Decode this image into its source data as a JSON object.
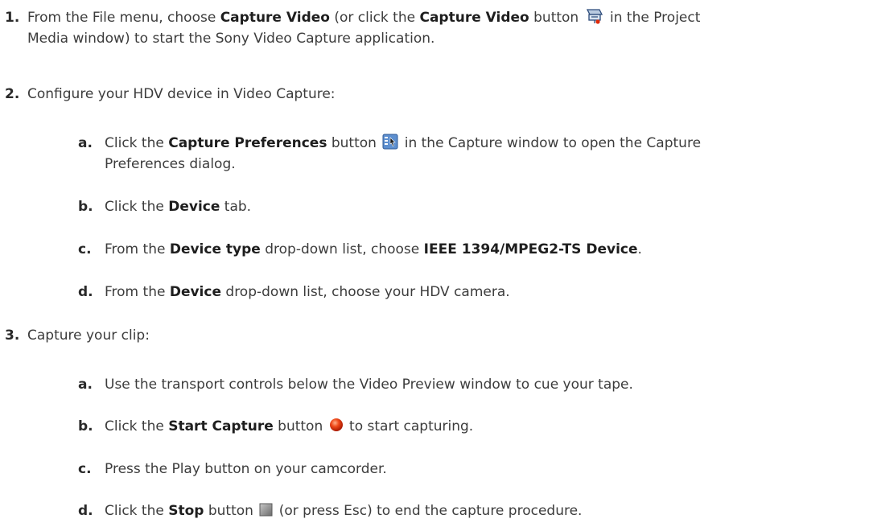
{
  "s1": {
    "num": "1.",
    "t1": "From the File menu, choose ",
    "b1": "Capture Video",
    "t2": " (or click the ",
    "b2": "Capture Video",
    "t3": " button ",
    "t4": " in the Project",
    "t5": "Media window) to start the Sony Video Capture application."
  },
  "s2": {
    "num": "2.",
    "text": "Configure your HDV device in Video Capture:",
    "a": {
      "letter": "a.",
      "t1": "Click the ",
      "b1": "Capture Preferences",
      "t2": " button ",
      "t3": " in the Capture window to open the Capture",
      "t4": "Preferences dialog."
    },
    "b": {
      "letter": "b.",
      "t1": "Click the ",
      "b1": "Device",
      "t2": " tab."
    },
    "c": {
      "letter": "c.",
      "t1": "From the ",
      "b1": "Device type",
      "t2": " drop-down list, choose ",
      "b2": "IEEE 1394/MPEG2-TS Device",
      "t3": "."
    },
    "d": {
      "letter": "d.",
      "t1": "From the ",
      "b1": "Device",
      "t2": " drop-down list, choose your HDV camera."
    }
  },
  "s3": {
    "num": "3.",
    "text": "Capture your clip:",
    "a": {
      "letter": "a.",
      "text": "Use the transport controls below the Video Preview window to cue your tape."
    },
    "b": {
      "letter": "b.",
      "t1": "Click the ",
      "b1": "Start Capture",
      "t2": " button ",
      "t3": " to start capturing."
    },
    "c": {
      "letter": "c.",
      "text": "Press the Play button on your camcorder."
    },
    "d": {
      "letter": "d.",
      "t1": "Click the ",
      "b1": "Stop",
      "t2": " button ",
      "t3": " (or press Esc) to end the capture procedure."
    }
  },
  "icons": {
    "capture_video": "capture-video-icon",
    "capture_preferences": "capture-preferences-icon",
    "start_capture": "record-icon",
    "stop": "stop-icon"
  },
  "colors": {
    "text": "#3c3c3c",
    "record": "#e02a0a"
  }
}
